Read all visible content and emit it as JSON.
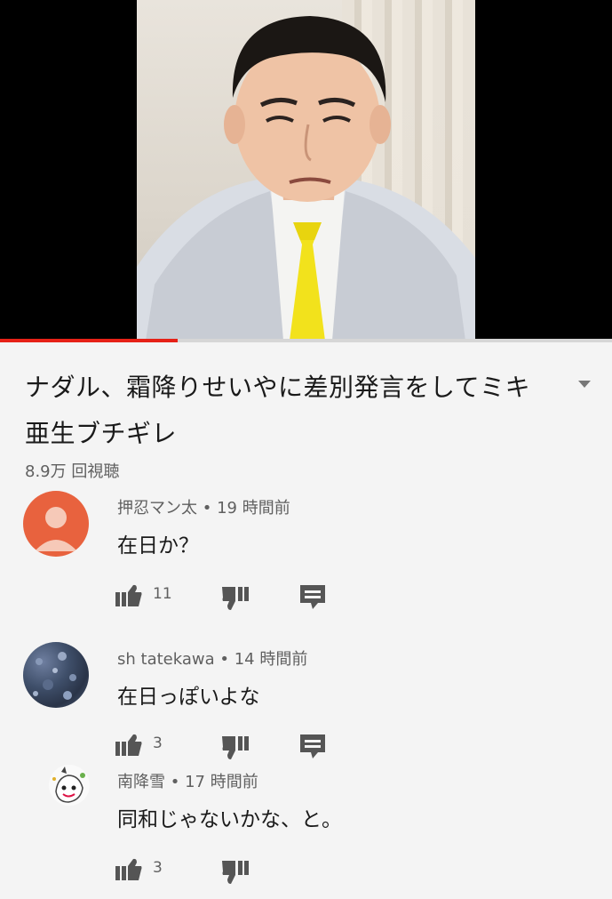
{
  "video": {
    "title": "ナダル、霜降りせいやに差別発言をしてミキ亜生ブチギレ",
    "views": "8.9万 回視聴",
    "progress": 0.29,
    "accent_color": "#e62117"
  },
  "comments": [
    {
      "author": "押忍マン太",
      "time": "19 時間前",
      "text": "在日か？",
      "likes": "11",
      "avatar": "default-person-avatar",
      "avatar_color": "#e8623e"
    },
    {
      "author": "sh tatekawa",
      "time": "14 時間前",
      "text": "在日っぽいよな",
      "likes": "3",
      "avatar": "textured-photo-avatar"
    },
    {
      "author": "南降雪",
      "time": "17 時間前",
      "text": "同和じゃないかな、と。",
      "likes": "3",
      "avatar": "cartoon-avatar"
    }
  ],
  "separator": "•"
}
